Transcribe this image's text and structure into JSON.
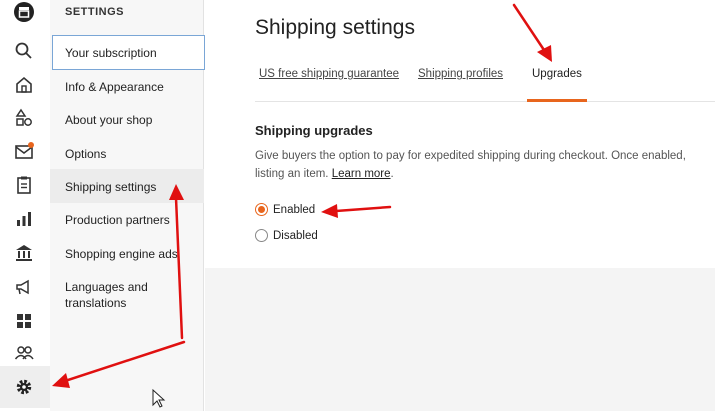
{
  "rail": {
    "icons": [
      "shop-icon",
      "search-icon",
      "home-icon",
      "listings-icon",
      "messages-icon",
      "orders-icon",
      "stats-icon",
      "finances-icon",
      "marketing-icon",
      "integrations-icon",
      "community-icon",
      "settings-icon"
    ],
    "message_badge_color": "#e8651d"
  },
  "subnav": {
    "title": "SETTINGS",
    "items": [
      {
        "label": "Your subscription"
      },
      {
        "label": "Info & Appearance"
      },
      {
        "label": "About your shop"
      },
      {
        "label": "Options"
      },
      {
        "label": "Shipping settings"
      },
      {
        "label": "Production partners"
      },
      {
        "label": "Shopping engine ads"
      },
      {
        "label": "Languages and translations"
      }
    ]
  },
  "main": {
    "title": "Shipping settings",
    "tabs": [
      {
        "label": "US free shipping guarantee"
      },
      {
        "label": "Shipping profiles"
      },
      {
        "label": "Upgrades"
      }
    ],
    "section": {
      "title": "Shipping upgrades",
      "desc_line1": "Give buyers the option to pay for expedited shipping during checkout. Once enabled,",
      "desc_line2": "listing an item.",
      "learn_more": "Learn more",
      "period": "."
    },
    "options": [
      {
        "label": "Enabled",
        "checked": true
      },
      {
        "label": "Disabled",
        "checked": false
      }
    ]
  },
  "colors": {
    "accent": "#e8651d",
    "annotation": "#e01010"
  }
}
